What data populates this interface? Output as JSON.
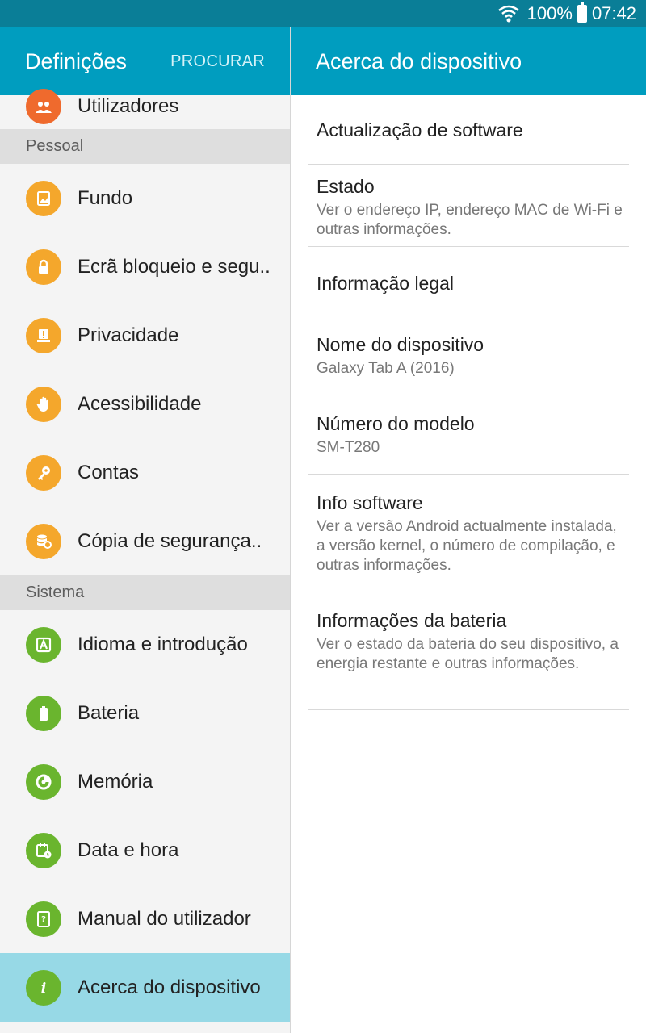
{
  "status": {
    "battery": "100%",
    "time": "07:42"
  },
  "left": {
    "title": "Definições",
    "search_label": "PROCURAR",
    "top_partial": {
      "label": "Utilizadores",
      "icon": "users-icon"
    },
    "sections": [
      {
        "header": "Pessoal",
        "items": [
          {
            "label": "Fundo",
            "icon": "wallpaper-icon"
          },
          {
            "label": "Ecrã bloqueio e segu..",
            "icon": "lock-icon"
          },
          {
            "label": "Privacidade",
            "icon": "privacy-icon"
          },
          {
            "label": "Acessibilidade",
            "icon": "hand-icon"
          },
          {
            "label": "Contas",
            "icon": "key-icon"
          },
          {
            "label": "Cópia de segurança..",
            "icon": "backup-icon"
          }
        ]
      },
      {
        "header": "Sistema",
        "items": [
          {
            "label": "Idioma e introdução",
            "icon": "language-icon"
          },
          {
            "label": "Bateria",
            "icon": "battery-icon"
          },
          {
            "label": "Memória",
            "icon": "memory-icon"
          },
          {
            "label": "Data e hora",
            "icon": "calendar-clock-icon"
          },
          {
            "label": "Manual do utilizador",
            "icon": "manual-icon"
          },
          {
            "label": "Acerca do dispositivo",
            "icon": "info-icon"
          }
        ]
      }
    ]
  },
  "right": {
    "title": "Acerca do dispositivo",
    "rows": [
      {
        "title": "Actualização de software",
        "subtitle": ""
      },
      {
        "title": "Estado",
        "subtitle": "Ver o endereço IP, endereço MAC de Wi-Fi e outras informações."
      },
      {
        "title": "Informação legal",
        "subtitle": ""
      },
      {
        "title": "Nome do dispositivo",
        "subtitle": "Galaxy Tab A (2016)"
      },
      {
        "title": "Número do modelo",
        "subtitle": "SM-T280"
      },
      {
        "title": "Info software",
        "subtitle": "Ver a versão Android actualmente instalada, a versão kernel, o número de compilação, e outras informações."
      },
      {
        "title": "Informações da bateria",
        "subtitle": "Ver o estado da bateria do seu dispositivo, a energia restante e outras informações."
      }
    ]
  },
  "colors": {
    "header": "#009dbf",
    "statusbar": "#0a7e97",
    "active": "#97d9e6",
    "orange": "#f4a72c",
    "green": "#6ab52e"
  }
}
